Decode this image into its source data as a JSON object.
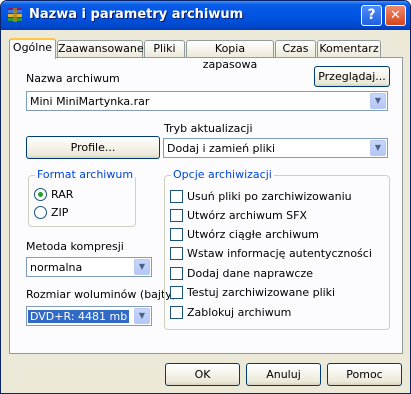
{
  "window": {
    "title": "Nazwa i parametry archiwum",
    "help_glyph": "?",
    "close_glyph": "✕"
  },
  "tabs": [
    {
      "label": "Ogólne",
      "active": true
    },
    {
      "label": "Zaawansowane"
    },
    {
      "label": "Pliki"
    },
    {
      "label": "Kopia zapasowa"
    },
    {
      "label": "Czas"
    },
    {
      "label": "Komentarz"
    }
  ],
  "general": {
    "archive_name_label": "Nazwa archiwum",
    "browse_label": "Przeglądaj...",
    "archive_name_value": "Mini MiniMartynka.rar",
    "profiles_label": "Profile...",
    "update_mode_label": "Tryb aktualizacji",
    "update_mode_value": "Dodaj i zamień pliki",
    "format_group_label": "Format archiwum",
    "format_rar": "RAR",
    "format_zip": "ZIP",
    "format_selected": "RAR",
    "compression_label": "Metoda kompresji",
    "compression_value": "normalna",
    "volume_label": "Rozmiar woluminów (bajty)",
    "volume_value": "DVD+R: 4481 mb",
    "options_group_label": "Opcje archiwizacji",
    "options": [
      {
        "label": "Usuń pliki po zarchiwizowaniu",
        "checked": false
      },
      {
        "label": "Utwórz archiwum SFX",
        "checked": false
      },
      {
        "label": "Utwórz ciągłe archiwum",
        "checked": false
      },
      {
        "label": "Wstaw informację autentyczności",
        "checked": false
      },
      {
        "label": "Dodaj dane naprawcze",
        "checked": false
      },
      {
        "label": "Testuj zarchiwizowane pliki",
        "checked": false
      },
      {
        "label": "Zablokuj archiwum",
        "checked": false
      }
    ]
  },
  "buttons": {
    "ok": "OK",
    "cancel": "Anuluj",
    "help": "Pomoc"
  }
}
